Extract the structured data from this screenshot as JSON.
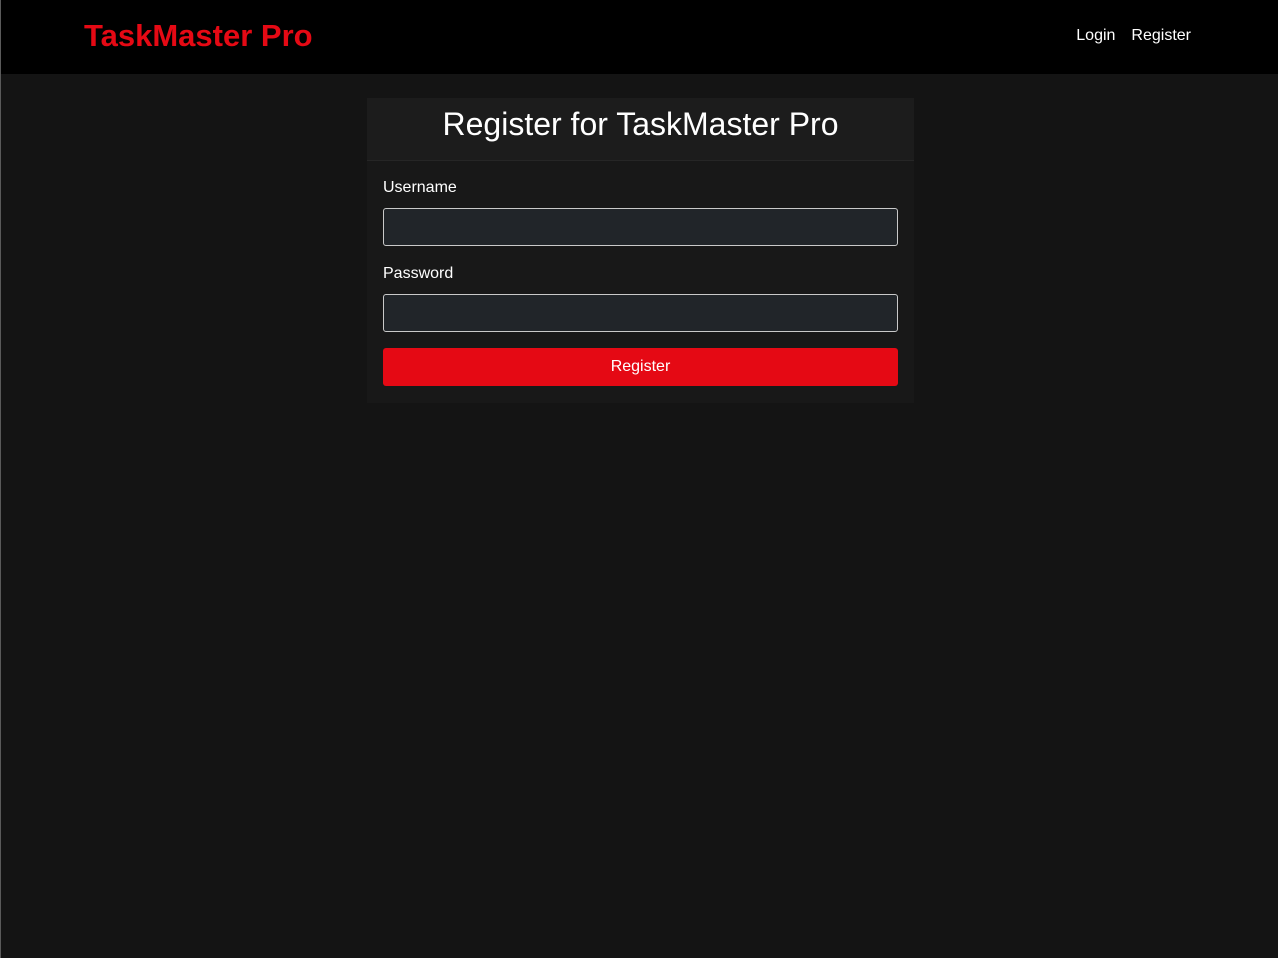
{
  "nav": {
    "brand": "TaskMaster Pro",
    "links": [
      {
        "label": "Login"
      },
      {
        "label": "Register"
      }
    ]
  },
  "form": {
    "title": "Register for TaskMaster Pro",
    "username_label": "Username",
    "username_value": "",
    "password_label": "Password",
    "password_value": "",
    "submit_label": "Register"
  },
  "colors": {
    "accent": "#e50914",
    "page_background": "#141414",
    "navbar_background": "#000000",
    "input_background": "#212529"
  }
}
